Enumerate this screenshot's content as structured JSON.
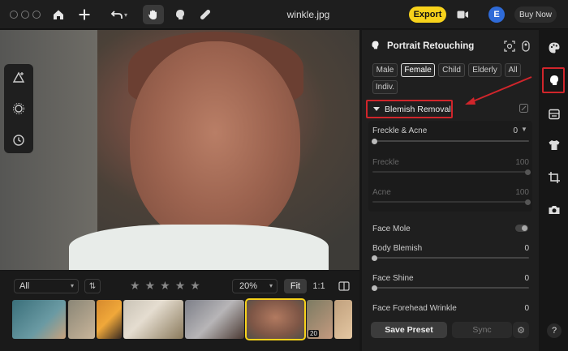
{
  "titlebar": {
    "filename": "winkle.jpg",
    "export_label": "Export",
    "avatar_letter": "E",
    "buy_label": "Buy Now"
  },
  "filmstrip": {
    "filter_value": "All",
    "zoom_value": "20%",
    "fit_label": "Fit",
    "one_to_one_label": "1:1",
    "thumb_badge": "20"
  },
  "panel": {
    "title": "Portrait Retouching",
    "chips": [
      "Male",
      "Female",
      "Child",
      "Elderly",
      "All",
      "Indiv."
    ],
    "active_chip": "Female",
    "section_title": "Blemish Removal",
    "sliders": {
      "freckle_acne": {
        "label": "Freckle & Acne",
        "value": "0"
      },
      "freckle": {
        "label": "Freckle",
        "value": "100"
      },
      "acne": {
        "label": "Acne",
        "value": "100"
      },
      "face_mole": {
        "label": "Face Mole"
      },
      "body_blemish": {
        "label": "Body Blemish",
        "value": "0"
      },
      "face_shine": {
        "label": "Face Shine",
        "value": "0"
      },
      "face_forehead_wrinkle": {
        "label": "Face Forehead Wrinkle",
        "value": "0"
      }
    },
    "save_preset_label": "Save Preset",
    "sync_label": "Sync"
  },
  "rail": {
    "help_label": "?"
  },
  "colors": {
    "accent": "#f7d21b",
    "highlight": "#d0252b",
    "avatar": "#2f6bd8"
  }
}
